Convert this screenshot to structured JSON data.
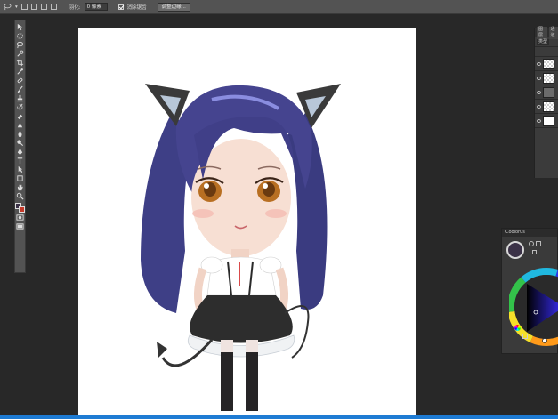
{
  "options_bar": {
    "feather_label": "羽化:",
    "feather_value": "0 像素",
    "antialias_label": "消除锯齿",
    "antialias_checked": true,
    "refine_edge_button": "调整边缘..."
  },
  "toolbar": {
    "tools": [
      "move-tool",
      "marquee-tool",
      "lasso-tool",
      "quick-select-tool",
      "crop-tool",
      "eyedropper-tool",
      "healing-brush-tool",
      "brush-tool",
      "clone-stamp-tool",
      "history-brush-tool",
      "eraser-tool",
      "gradient-tool",
      "blur-tool",
      "dodge-tool",
      "pen-tool",
      "type-tool",
      "path-select-tool",
      "shape-tool",
      "hand-tool",
      "zoom-tool"
    ],
    "foreground_color": "#3b3247",
    "background_color": "#c43a2a"
  },
  "layers_panel": {
    "tabs": [
      "图层",
      "通道"
    ],
    "kind_filter": "类型",
    "layers": [
      {
        "thumb": "checker"
      },
      {
        "thumb": "checker"
      },
      {
        "thumb": "folder"
      },
      {
        "thumb": "checker"
      },
      {
        "thumb": "white"
      }
    ]
  },
  "color_panel": {
    "title": "Coolorus",
    "current_color": "#3b3247",
    "triangle_color": "#3b2fff"
  }
}
